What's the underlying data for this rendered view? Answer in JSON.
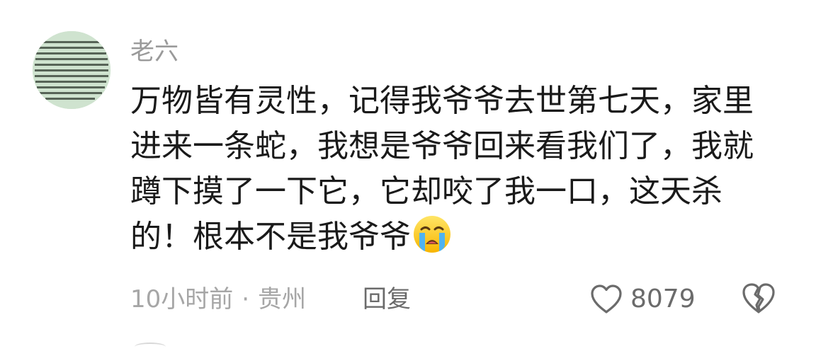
{
  "comment": {
    "author": "老六",
    "content_lines": [
      "万物皆有灵性，记得我爷爷去世第七天，家里",
      "进来一条蛇，我想是爷爷回来看我们了，我就",
      "蹲下摸了一下它，它却咬了我一口，这天杀",
      "的！根本不是我爷爷"
    ],
    "emoji": "crying-face-icon",
    "time": "10小时前",
    "separator": "·",
    "location": "贵州",
    "reply_label": "回复",
    "like_count": "8079",
    "colors": {
      "author": "#9a9a9a",
      "content": "#1a1a1a",
      "meta": "#a6a6a6",
      "actions": "#6b6b6b",
      "avatar_bg": "#cfe3cf"
    }
  }
}
